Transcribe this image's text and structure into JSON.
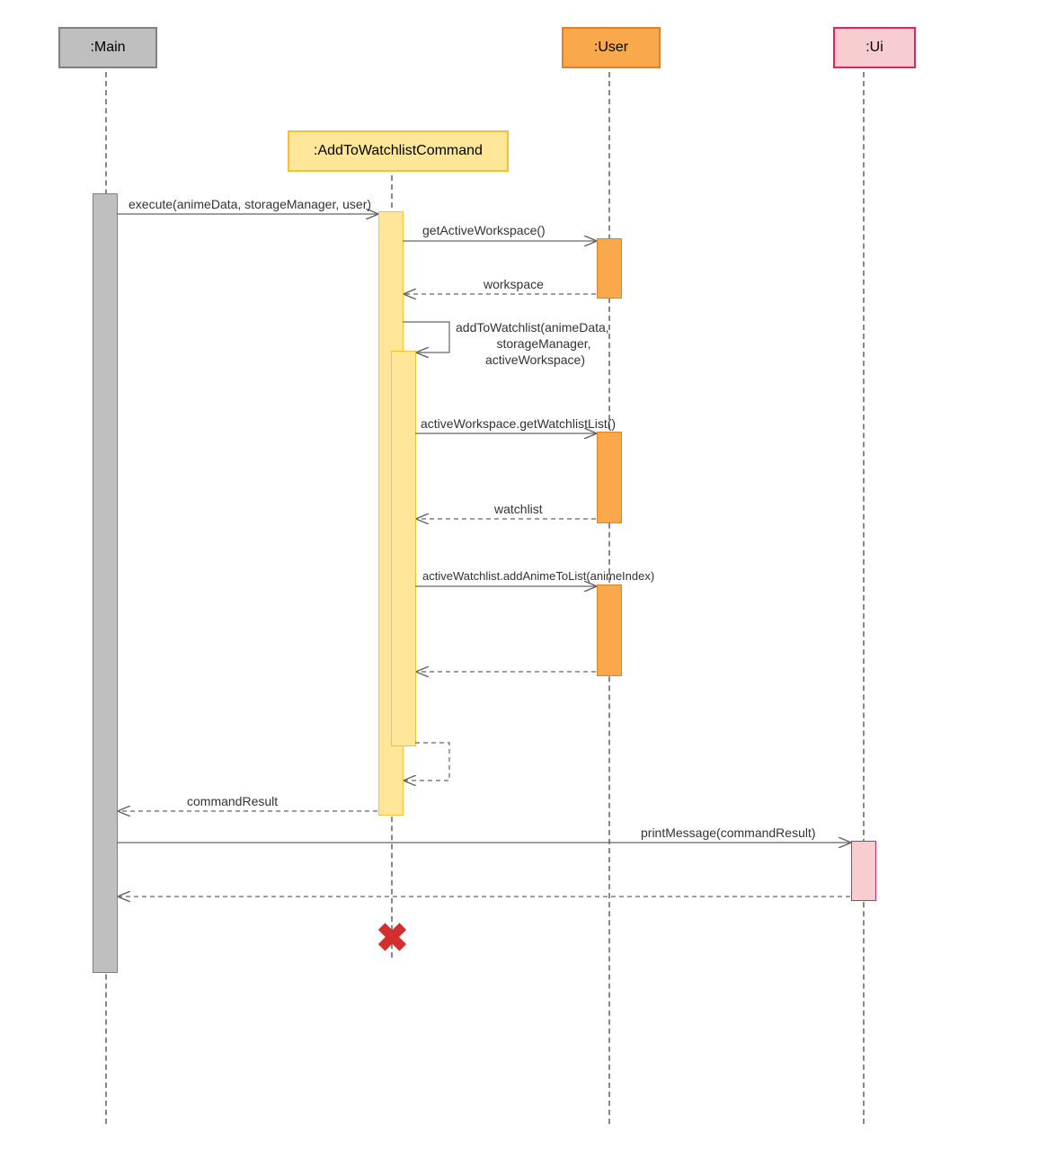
{
  "chart_data": {
    "type": "sequence_diagram",
    "participants": [
      {
        "id": "main",
        "label": ":Main",
        "color": "#bfbfbf",
        "border": "#808080"
      },
      {
        "id": "cmd",
        "label": ":AddToWatchlistCommand",
        "color": "#ffe699",
        "border": "#fbc02d",
        "created_late": true
      },
      {
        "id": "user",
        "label": ":User",
        "color": "#f9a94b",
        "border": "#e67e22"
      },
      {
        "id": "ui",
        "label": ":Ui",
        "color": "#f8cdd0",
        "border": "#e91e63"
      }
    ],
    "messages": [
      {
        "from": "main",
        "to": "cmd",
        "text": "execute(animeData, storageManager, user)",
        "type": "call"
      },
      {
        "from": "cmd",
        "to": "user",
        "text": "getActiveWorkspace()",
        "type": "call"
      },
      {
        "from": "user",
        "to": "cmd",
        "text": "workspace",
        "type": "return"
      },
      {
        "from": "cmd",
        "to": "cmd",
        "text": "addToWatchlist(animeData, storageManager, activeWorkspace)",
        "type": "self"
      },
      {
        "from": "cmd",
        "to": "user",
        "text": "activeWorkspace.getWatchlistList()",
        "type": "call"
      },
      {
        "from": "user",
        "to": "cmd",
        "text": "watchlist",
        "type": "return"
      },
      {
        "from": "cmd",
        "to": "user",
        "text": "activeWatchlist.addAnimeToList(animeIndex)",
        "type": "call"
      },
      {
        "from": "user",
        "to": "cmd",
        "text": "",
        "type": "return"
      },
      {
        "from": "cmd",
        "to": "cmd",
        "text": "",
        "type": "self_return"
      },
      {
        "from": "cmd",
        "to": "main",
        "text": "commandResult",
        "type": "return"
      },
      {
        "from": "main",
        "to": "ui",
        "text": "printMessage(commandResult)",
        "type": "call"
      },
      {
        "from": "ui",
        "to": "main",
        "text": "",
        "type": "return"
      }
    ],
    "destroy": [
      "cmd"
    ]
  },
  "labels": {
    "msg1": "execute(animeData, storageManager, user)",
    "msg2": "getActiveWorkspace()",
    "msg3": "workspace",
    "msg4a": "addToWatchlist(animeData,",
    "msg4b": "storageManager,",
    "msg4c": "activeWorkspace)",
    "msg5": "activeWorkspace.getWatchlistList()",
    "msg6": "watchlist",
    "msg7": "activeWatchlist.addAnimeToList(animeIndex)",
    "msg8": "commandResult",
    "msg9": "printMessage(commandResult)"
  },
  "participants": {
    "main": ":Main",
    "cmd": ":AddToWatchlistCommand",
    "user": ":User",
    "ui": ":Ui"
  }
}
